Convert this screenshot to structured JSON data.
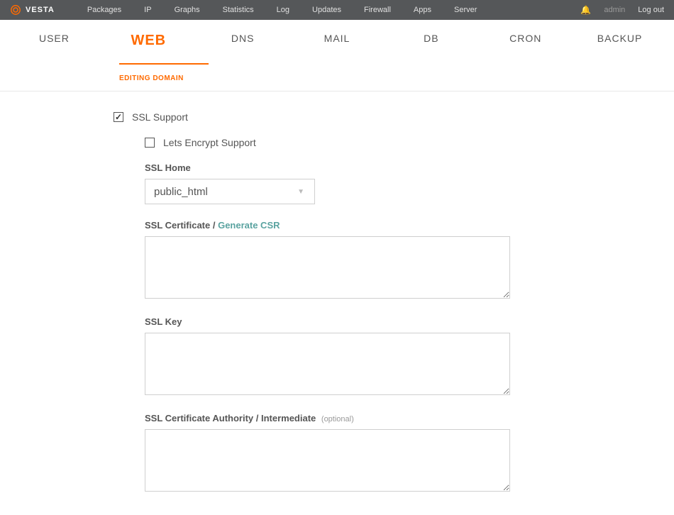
{
  "logo": {
    "text": "VESTA"
  },
  "topnav": [
    "Packages",
    "IP",
    "Graphs",
    "Statistics",
    "Log",
    "Updates",
    "Firewall",
    "Apps",
    "Server"
  ],
  "topright": {
    "user": "admin",
    "logout": "Log out"
  },
  "tabs": [
    {
      "label": "USER",
      "active": false
    },
    {
      "label": "WEB",
      "active": true
    },
    {
      "label": "DNS",
      "active": false
    },
    {
      "label": "MAIL",
      "active": false
    },
    {
      "label": "DB",
      "active": false
    },
    {
      "label": "CRON",
      "active": false
    },
    {
      "label": "BACKUP",
      "active": false
    }
  ],
  "subtitle": "EDITING DOMAIN",
  "form": {
    "ssl_support": {
      "label": "SSL Support",
      "checked": true
    },
    "lets_encrypt": {
      "label": "Lets Encrypt Support",
      "checked": false
    },
    "ssl_home": {
      "label": "SSL Home",
      "value": "public_html"
    },
    "ssl_cert": {
      "label": "SSL Certificate / ",
      "link": "Generate CSR",
      "value": ""
    },
    "ssl_key": {
      "label": "SSL Key",
      "value": ""
    },
    "ssl_ca": {
      "label": "SSL Certificate Authority / Intermediate",
      "optional": "(optional)",
      "value": ""
    }
  }
}
